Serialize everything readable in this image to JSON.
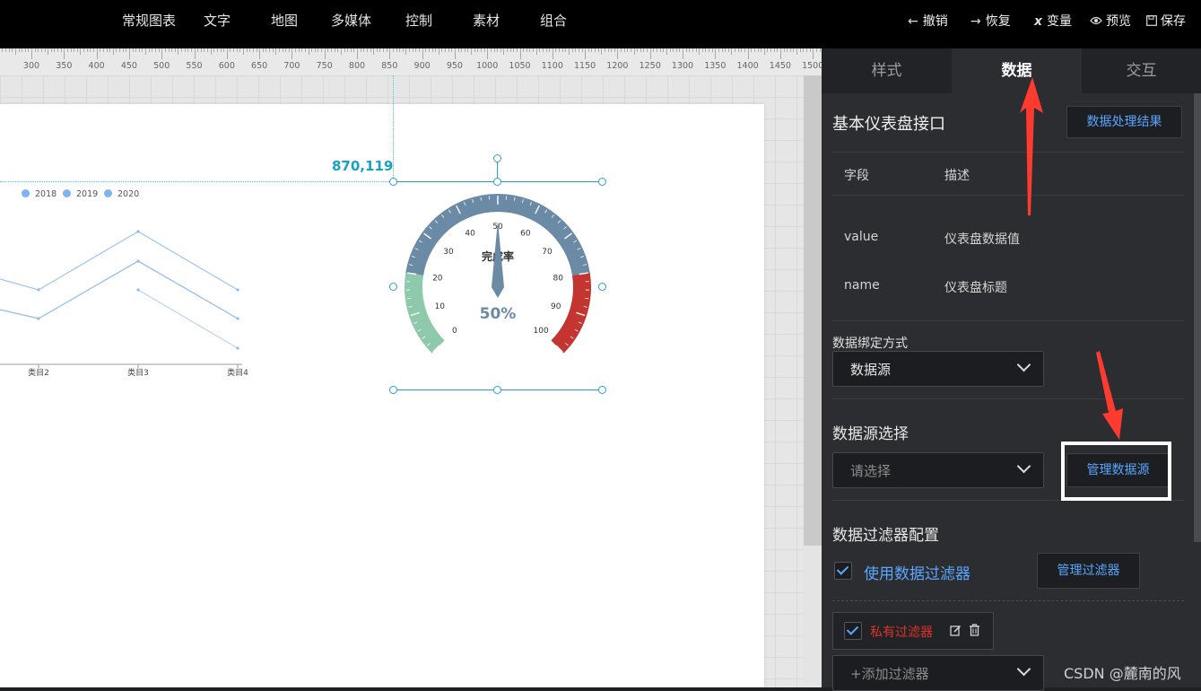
{
  "topbar": {
    "nav": [
      "常规图表",
      "文字",
      "地图",
      "多媒体",
      "控制",
      "素材",
      "组合"
    ],
    "undo": "撤销",
    "redo": "恢复",
    "variable": "变量",
    "preview": "预览",
    "save": "保存"
  },
  "ruler": {
    "labels": [
      "300",
      "350",
      "400",
      "450",
      "500",
      "550",
      "600",
      "650",
      "700",
      "750",
      "800",
      "850",
      "900",
      "950",
      "1000",
      "1050",
      "1100",
      "1150",
      "1200",
      "1250",
      "1300",
      "1350",
      "1400",
      "1450",
      "1500"
    ]
  },
  "canvas": {
    "coordinate": "870,119",
    "line_chart": {
      "legend": [
        "2018",
        "2019",
        "2020"
      ],
      "x_labels": [
        "类目2",
        "类目3",
        "类目4"
      ]
    },
    "gauge": {
      "title": "完成率",
      "value": 50,
      "value_text": "50%",
      "min": 0,
      "max": 100,
      "tick_labels": [
        "0",
        "10",
        "20",
        "30",
        "40",
        "50",
        "60",
        "70",
        "80",
        "90",
        "100"
      ],
      "colors": {
        "low": "#8fc9ab",
        "mid": "#6a8aa6",
        "high": "#c23531"
      }
    }
  },
  "panel": {
    "tabs": [
      "样式",
      "数据",
      "交互"
    ],
    "interface_title": "基本仪表盘接口",
    "process_result_button": "数据处理结果",
    "table": {
      "headers": [
        "字段",
        "描述"
      ],
      "rows": [
        [
          "value",
          "仪表盘数据值"
        ],
        [
          "name",
          "仪表盘标题"
        ]
      ]
    },
    "bind_label": "数据绑定方式",
    "bind_value": "数据源",
    "source_label": "数据源选择",
    "source_placeholder": "请选择",
    "manage_source_button": "管理数据源",
    "filter_config_label": "数据过滤器配置",
    "use_filter_label": "使用数据过滤器",
    "manage_filter_button": "管理过滤器",
    "private_filter_label": "私有过滤器",
    "add_filter_placeholder": "+添加过滤器"
  },
  "watermark": "CSDN @麓南的风"
}
